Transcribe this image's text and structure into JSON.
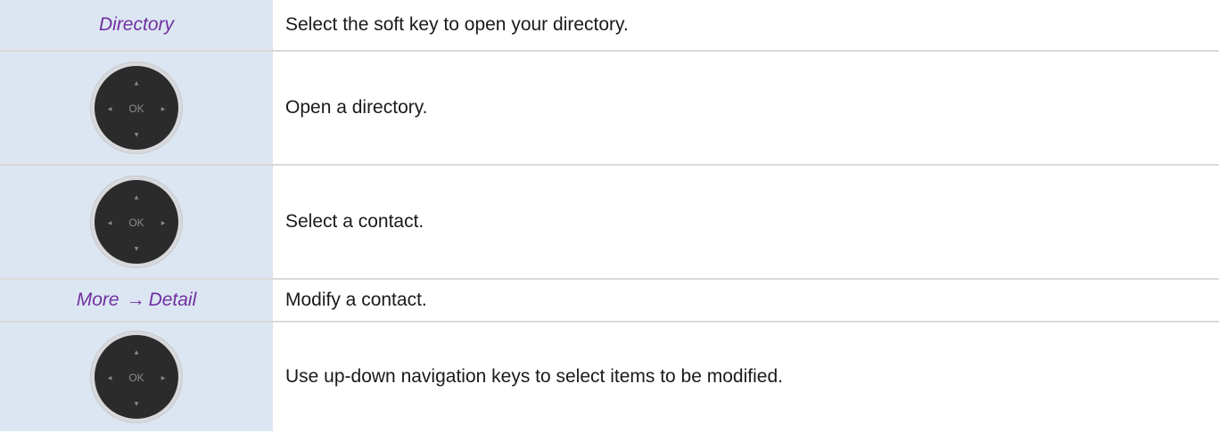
{
  "rows": [
    {
      "left_label": "Directory",
      "description": "Select the soft key to open your directory."
    },
    {
      "left_icon": "navigation-pad-icon",
      "description": "Open a directory."
    },
    {
      "left_icon": "navigation-pad-icon",
      "description": "Select a contact."
    },
    {
      "left_label_a": "More",
      "left_arrow": "→",
      "left_label_b": "Detail",
      "description": "Modify a contact."
    },
    {
      "left_icon": "navigation-pad-icon",
      "description": "Use up-down navigation keys to select items to be modified."
    }
  ],
  "navpad": {
    "ok_label": "OK",
    "up_glyph": "▲",
    "down_glyph": "▼",
    "left_glyph": "◀",
    "right_glyph": "▶"
  },
  "colors": {
    "left_cell_bg": "#dce6f2",
    "softkey_text": "#7030a0",
    "navpad_body": "#2b2b2b",
    "navpad_ring": "#d7d9dc"
  }
}
